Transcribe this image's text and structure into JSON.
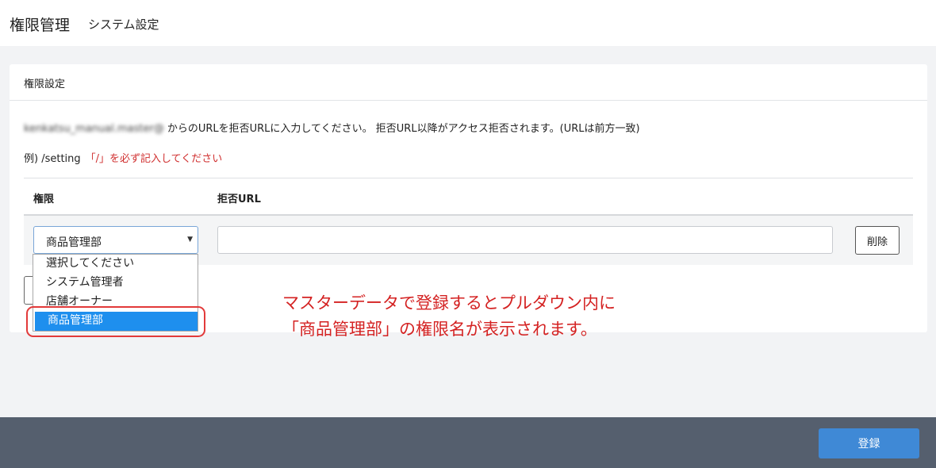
{
  "header": {
    "title": "権限管理",
    "subtitle": "システム設定"
  },
  "card": {
    "title": "権限設定",
    "description_blurred": "kenkatsu_manual.master@",
    "description_text": "からのURLを拒否URLに入力してください。 拒否URL以降がアクセス拒否されます。(URLは前方一致)",
    "example_text": "例) /setting",
    "example_note": "「/」を必ず記入してください"
  },
  "table": {
    "headers": [
      "権限",
      "拒否URL"
    ],
    "row": {
      "role_value": "商品管理部",
      "url_value": "",
      "delete_label": "削除"
    }
  },
  "dropdown": {
    "options": [
      "選択してください",
      "システム管理者",
      "店舗オーナー",
      "商品管理部"
    ],
    "selected_index": 3
  },
  "annotation": {
    "line1": "マスターデータで登録するとプルダウン内に",
    "line2": "「商品管理部」の権限名が表示されます。"
  },
  "footer": {
    "register_label": "登録"
  },
  "colors": {
    "accent": "#3f89d6",
    "selected_option": "#1e8fee",
    "annotation": "#d42222",
    "footer_bg": "#555f6e"
  },
  "icons": {
    "caret": "caret-down-icon"
  }
}
